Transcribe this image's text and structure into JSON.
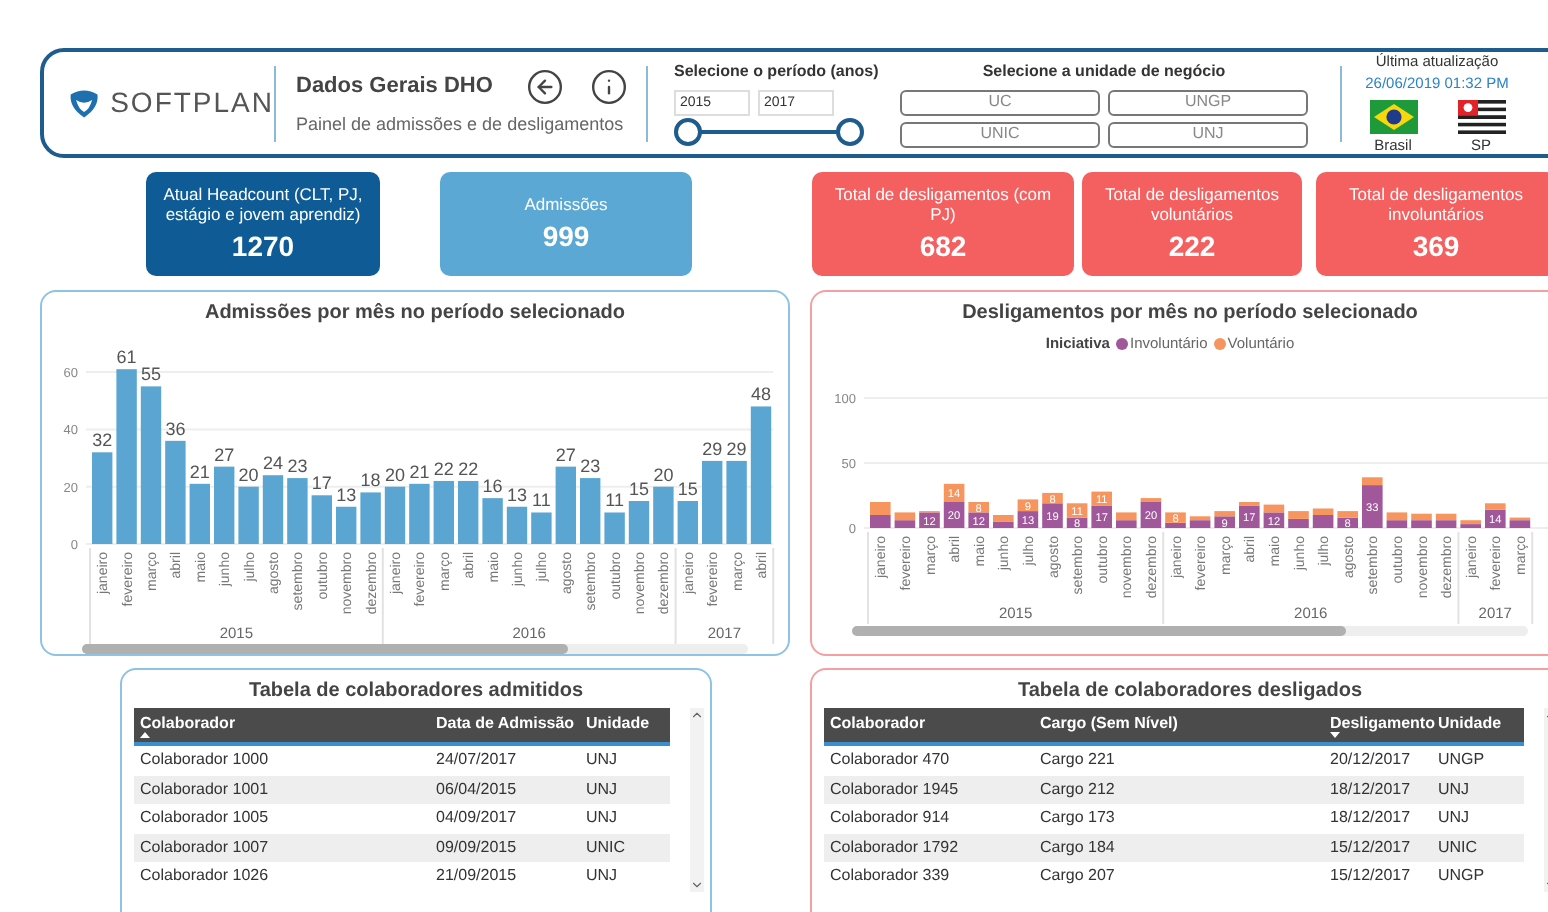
{
  "header": {
    "logo_text": "SOFTPLAN",
    "title": "Dados Gerais DHO",
    "subtitle": "Painel de admissões e de desligamentos",
    "period": {
      "label": "Selecione o período (anos)",
      "start": "2015",
      "end": "2017",
      "handles": [
        {
          "level": 0
        },
        {
          "level": 1
        }
      ]
    },
    "business_unit": {
      "label": "Selecione a unidade de negócio",
      "options": [
        {
          "label": "UC",
          "selected": false
        },
        {
          "label": "UNGP",
          "selected": false
        },
        {
          "label": "UNIC",
          "selected": false
        },
        {
          "label": "UNJ",
          "selected": false
        }
      ]
    },
    "last_update": {
      "label": "Última atualização",
      "datetime": "26/06/2019 01:32 PM",
      "flags": [
        {
          "kind": "brazil",
          "label": "Brasil"
        },
        {
          "kind": "sp",
          "label": "SP"
        }
      ]
    }
  },
  "kpis": [
    {
      "label": "Atual Headcount (CLT, PJ, estágio e jovem aprendiz)",
      "value": "1270",
      "color": "#0e5b95"
    },
    {
      "label": "Admissões",
      "value": "999",
      "color": "#5ca8d5"
    },
    {
      "label": "Total de desligamentos (com PJ)",
      "value": "682",
      "color": "#f45f5f"
    },
    {
      "label": "Total de desligamentos voluntários",
      "value": "222",
      "color": "#f45f5f"
    },
    {
      "label": "Total de desligamentos involuntários",
      "value": "369",
      "color": "#f45f5f"
    }
  ],
  "admissions_chart": {
    "chart_data": {
      "type": "bar",
      "title": "Admissões por mês no período selecionado",
      "categories": [
        "janeiro",
        "fevereiro",
        "março",
        "abril",
        "maio",
        "junho",
        "julho",
        "agosto",
        "setembro",
        "outubro",
        "novembro",
        "dezembro",
        "janeiro",
        "fevereiro",
        "março",
        "abril",
        "maio",
        "junho",
        "julho",
        "agosto",
        "setembro",
        "outubro",
        "novembro",
        "dezembro",
        "janeiro",
        "fevereiro",
        "março",
        "abril"
      ],
      "annotations": [
        "2015",
        "2016",
        "2017"
      ],
      "series": [
        {
          "color": "#5aa5d1",
          "values": [
            32,
            61,
            55,
            36,
            21,
            27,
            20,
            24,
            23,
            17,
            13,
            18,
            20,
            21,
            22,
            22,
            16,
            13,
            11,
            27,
            23,
            11,
            15,
            20,
            15,
            29,
            29,
            48
          ]
        }
      ],
      "ylim": [
        0,
        61
      ],
      "yticks": [
        0,
        20,
        40,
        60
      ],
      "grid": true,
      "data_labels": true
    }
  },
  "dismissals_chart": {
    "chart_data": {
      "type": "bar",
      "title": "Desligamentos por mês no período selecionado",
      "legend_title": "Iniciativa",
      "stacked": true,
      "categories": [
        "janeiro",
        "fevereiro",
        "março",
        "abril",
        "maio",
        "junho",
        "julho",
        "agosto",
        "setembro",
        "outubro",
        "novembro",
        "dezembro",
        "janeiro",
        "fevereiro",
        "março",
        "abril",
        "maio",
        "junho",
        "julho",
        "agosto",
        "setembro",
        "outubro",
        "novembro",
        "dezembro",
        "janeiro",
        "fevereiro",
        "março"
      ],
      "annotations": [
        "2015",
        "2016",
        "2017"
      ],
      "series": [
        {
          "name": "Involuntário",
          "color": "#a0589b",
          "values": [
            10,
            6,
            12,
            20,
            12,
            5,
            13,
            19,
            8,
            17,
            6,
            20,
            4,
            6,
            9,
            17,
            12,
            7,
            10,
            8,
            33,
            6,
            6,
            6,
            3,
            14,
            6
          ],
          "value_labels": [
            null,
            null,
            "12",
            "20",
            "12",
            null,
            "13",
            "19",
            "8",
            "17",
            null,
            "20",
            null,
            null,
            "9",
            "17",
            "12",
            null,
            null,
            "8",
            "33",
            null,
            null,
            null,
            null,
            "14",
            null
          ]
        },
        {
          "name": "Voluntário",
          "color": "#f7955f",
          "values": [
            10,
            6,
            1,
            14,
            8,
            5,
            9,
            8,
            11,
            11,
            6,
            3,
            8,
            3,
            4,
            3,
            6,
            6,
            5,
            5,
            6,
            6,
            5,
            5,
            3,
            5,
            2
          ],
          "value_labels": [
            null,
            null,
            null,
            "14",
            "8",
            null,
            "9",
            "8",
            "11",
            "11",
            null,
            null,
            "8",
            null,
            null,
            null,
            null,
            null,
            null,
            null,
            null,
            null,
            null,
            null,
            null,
            null,
            null
          ]
        }
      ],
      "ylim": [
        0,
        100
      ],
      "yticks": [
        0,
        50,
        100
      ],
      "grid": true
    }
  },
  "admitted_table": {
    "title": "Tabela de colaboradores admitidos",
    "columns": [
      {
        "label": "Colaborador",
        "sorted": true,
        "descending": false
      },
      {
        "label": "Data de Admissão",
        "sorted": false
      },
      {
        "label": "Unidade",
        "sorted": false
      }
    ],
    "rows": [
      [
        "Colaborador 1000",
        "24/07/2017",
        "UNJ"
      ],
      [
        "Colaborador 1001",
        "06/04/2015",
        "UNJ"
      ],
      [
        "Colaborador 1005",
        "04/09/2017",
        "UNJ"
      ],
      [
        "Colaborador 1007",
        "09/09/2015",
        "UNIC"
      ],
      [
        "Colaborador 1026",
        "21/09/2015",
        "UNJ"
      ]
    ]
  },
  "dismissed_table": {
    "title": "Tabela de colaboradores desligados",
    "columns": [
      {
        "label": "Colaborador",
        "sorted": false
      },
      {
        "label": "Cargo (Sem Nível)",
        "sorted": false
      },
      {
        "label": "Desligamento",
        "sorted": true,
        "descending": true
      },
      {
        "label": "Unidade",
        "sorted": false
      }
    ],
    "rows": [
      [
        "Colaborador 470",
        "Cargo 221",
        "20/12/2017",
        "UNGP"
      ],
      [
        "Colaborador 1945",
        "Cargo 212",
        "18/12/2017",
        "UNJ"
      ],
      [
        "Colaborador 914",
        "Cargo 173",
        "18/12/2017",
        "UNJ"
      ],
      [
        "Colaborador 1792",
        "Cargo 184",
        "15/12/2017",
        "UNIC"
      ],
      [
        "Colaborador 339",
        "Cargo 207",
        "15/12/2017",
        "UNGP"
      ]
    ]
  }
}
